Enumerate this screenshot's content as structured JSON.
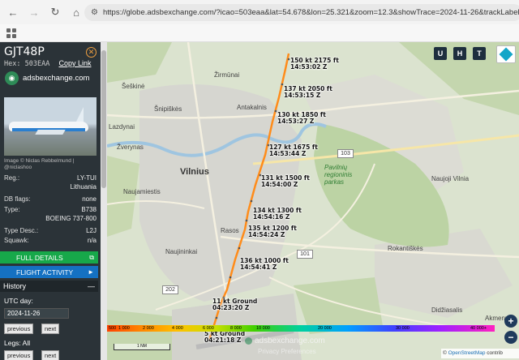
{
  "browser": {
    "url": "https://globe.adsbexchange.com/?icao=503eaa&lat=54.678&lon=25.321&zoom=12.3&showTrace=2024-11-26&trackLabels"
  },
  "sidebar": {
    "callsign": "GJT48P",
    "hex_label": "Hex:",
    "hex": "503EAA",
    "copy_link": "Copy Link",
    "brand": "adsbexchange.com",
    "photo_credit": "Image © Niclas Rebbelmund | @niclashoo",
    "details": [
      {
        "key": "Reg.:",
        "value": "LY-TUI"
      },
      {
        "key": "",
        "value": "Lithuania"
      },
      {
        "key": "DB flags:",
        "value": "none"
      },
      {
        "key": "Type:",
        "value": "B738"
      },
      {
        "key": "",
        "value": "BOEING 737-800"
      },
      {
        "key": "Type Desc.:",
        "value": "L2J"
      },
      {
        "key": "Squawk:",
        "value": "n/a"
      }
    ],
    "full_details": "FULL DETAILS",
    "flight_activity": "FLIGHT ACTIVITY",
    "history": "History",
    "utc_day": "UTC day:",
    "date": "2024-11-26",
    "previous": "previous",
    "next": "next",
    "legs": "Legs: All"
  },
  "map": {
    "places": [
      {
        "name": "Žirmūnai",
        "cls": ""
      },
      {
        "name": "Šeškinė",
        "cls": ""
      },
      {
        "name": "Antakalnis",
        "cls": ""
      },
      {
        "name": "Šnipiškės",
        "cls": ""
      },
      {
        "name": "Žverynas",
        "cls": ""
      },
      {
        "name": "Vilnius",
        "cls": "big"
      },
      {
        "name": "Naujamiestis",
        "cls": ""
      },
      {
        "name": "Pavilnių regioninis parkas",
        "cls": "park"
      },
      {
        "name": "Naujoji Vilnia",
        "cls": ""
      },
      {
        "name": "Rasos",
        "cls": ""
      },
      {
        "name": "Naujininkai",
        "cls": ""
      },
      {
        "name": "Rokantiškės",
        "cls": ""
      },
      {
        "name": "Didžiasalis",
        "cls": ""
      },
      {
        "name": "Akmeny",
        "cls": ""
      },
      {
        "name": "Lazdynai",
        "cls": ""
      }
    ],
    "roads": [
      "103",
      "101",
      "202"
    ],
    "track_labels": [
      {
        "speed_alt": "150 kt 2175 ft",
        "time": "14:53:02 Z"
      },
      {
        "speed_alt": "137 kt 2050 ft",
        "time": "14:53:15 Z"
      },
      {
        "speed_alt": "130 kt 1850 ft",
        "time": "14:53:27 Z"
      },
      {
        "speed_alt": "127 kt 1675 ft",
        "time": "14:53:44 Z"
      },
      {
        "speed_alt": "131 kt 1500 ft",
        "time": "14:54:00 Z"
      },
      {
        "speed_alt": "134 kt 1300 ft",
        "time": "14:54:16 Z"
      },
      {
        "speed_alt": "135 kt 1200 ft",
        "time": "14:54:24 Z"
      },
      {
        "speed_alt": "136 kt 1000 ft",
        "time": "14:54:41 Z"
      },
      {
        "speed_alt": "11 kt Ground",
        "time": "04:23:20 Z"
      },
      {
        "speed_alt": "5 kt Ground",
        "time": "04:21:18 Z"
      }
    ],
    "buttons": {
      "u": "U",
      "h": "H",
      "t": "T",
      "zoom_in": "+",
      "zoom_out": "−"
    },
    "altitude_legend": [
      "500",
      "1 000",
      "2 000",
      "4 000",
      "6 000",
      "8 000",
      "10 000",
      "20 000",
      "30 000",
      "40 000+"
    ],
    "scale": "1 NM",
    "watermark": "adsbexchange.com",
    "watermark2": "Privacy Preferences",
    "attribution_prefix": "© ",
    "attribution_osm": "OpenStreetMap",
    "attribution_suffix": " contrib",
    "track_color": "#ff8c1a"
  }
}
